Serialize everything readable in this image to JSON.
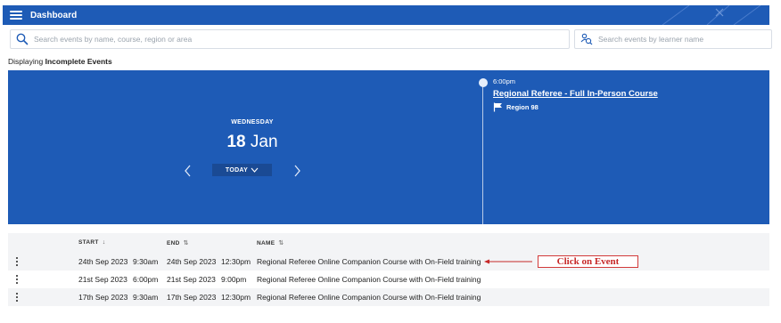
{
  "header": {
    "title": "Dashboard"
  },
  "search": {
    "events_placeholder": "Search events by name, course, region or area",
    "learner_placeholder": "Search events by learner name"
  },
  "display": {
    "prefix": "Displaying",
    "filter": "Incomplete Events"
  },
  "calendar": {
    "day_of_week": "WEDNESDAY",
    "day": "18",
    "month": "Jan",
    "today_label": "TODAY"
  },
  "event": {
    "time": "6:00pm",
    "title": "Regional Referee - Full In-Person Course",
    "region": "Region 98"
  },
  "table": {
    "columns": [
      {
        "label": "START",
        "sort": "↓"
      },
      {
        "label": "END",
        "sort": "⇅"
      },
      {
        "label": "NAME",
        "sort": "⇅"
      }
    ],
    "rows": [
      {
        "start_date": "24th Sep 2023",
        "start_time": "9:30am",
        "end_date": "24th Sep 2023",
        "end_time": "12:30pm",
        "name": "Regional Referee Online Companion Course with On-Field training"
      },
      {
        "start_date": "21st Sep 2023",
        "start_time": "6:00pm",
        "end_date": "21st Sep 2023",
        "end_time": "9:00pm",
        "name": "Regional Referee Online Companion Course with On-Field training"
      },
      {
        "start_date": "17th Sep 2023",
        "start_time": "9:30am",
        "end_date": "17th Sep 2023",
        "end_time": "12:30pm",
        "name": "Regional Referee Online Companion Course with On-Field training"
      }
    ]
  },
  "annotation": {
    "callout": "Click on Event"
  },
  "colors": {
    "brand_blue": "#1e5bb6",
    "annotation_red": "#c62828"
  },
  "icons": [
    "menu-icon",
    "search-icon",
    "learner-search-icon",
    "chevron-left-icon",
    "chevron-right-icon",
    "chevron-down-icon",
    "flag-icon",
    "kebab-icon"
  ]
}
